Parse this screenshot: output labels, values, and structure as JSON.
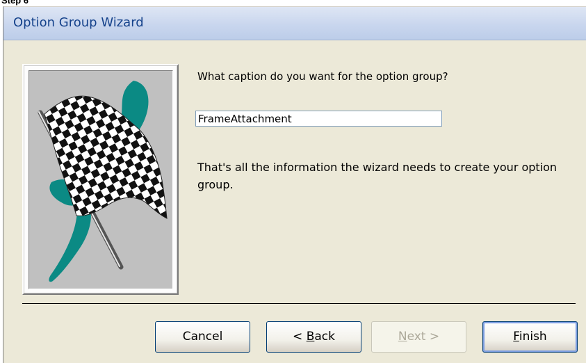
{
  "step_caption": "Step 6",
  "window": {
    "title": "Option Group Wizard"
  },
  "picture": {
    "icon": "checkered-flag-icon",
    "colors": {
      "flag_accent": "#0b8a84",
      "background": "#c0c0c0"
    }
  },
  "prompt": "What caption do you want for the option group?",
  "caption_input": {
    "value": "FrameAttachment"
  },
  "info_text": "That's all the information the wizard needs to create your option group.",
  "buttons": {
    "cancel": {
      "label": "Cancel"
    },
    "back": {
      "prefix": "< ",
      "mnemonic": "B",
      "rest": "ack"
    },
    "next": {
      "mnemonic": "N",
      "rest": "ext >",
      "enabled": false
    },
    "finish": {
      "mnemonic": "F",
      "rest": "inish",
      "default": true
    }
  },
  "colors": {
    "title_text": "#15428b",
    "dialog_bg": "#ece9d8",
    "button_border": "#003c74"
  }
}
